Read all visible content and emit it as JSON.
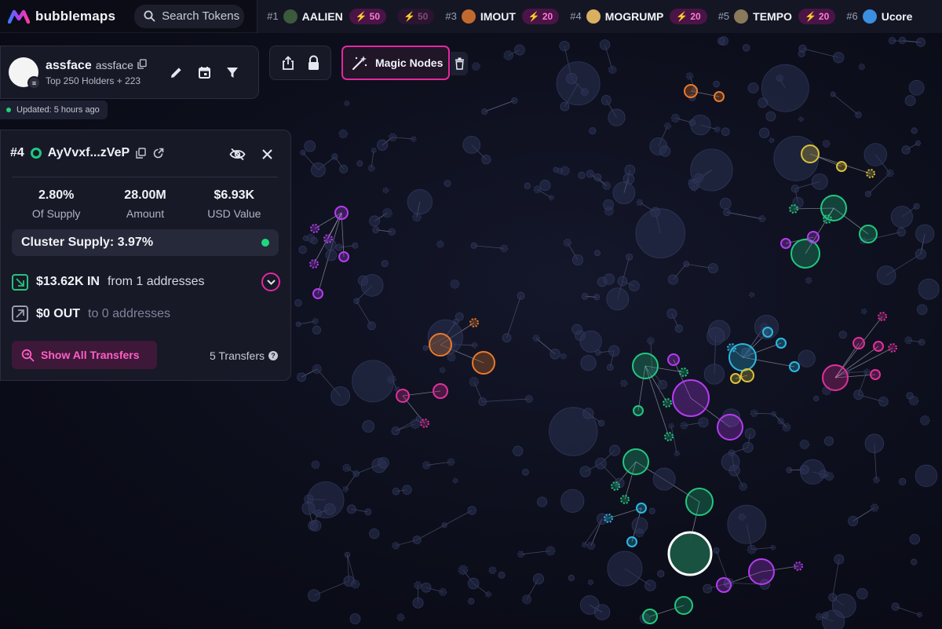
{
  "app": {
    "name": "bubblemaps"
  },
  "search": {
    "label": "Search Tokens"
  },
  "ticker": [
    {
      "rank": "#1",
      "name": "AALIEN",
      "boost": "50",
      "avatar": "#3c5a3c"
    },
    {
      "rank": "",
      "name": "",
      "boost": "50",
      "avatar": "",
      "faded": true
    },
    {
      "rank": "#3",
      "name": "IMOUT",
      "boost": "20",
      "avatar": "#c26a2e"
    },
    {
      "rank": "#4",
      "name": "MOGRUMP",
      "boost": "20",
      "avatar": "#d9b060"
    },
    {
      "rank": "#5",
      "name": "TEMPO",
      "boost": "20",
      "avatar": "#8a7a5a"
    },
    {
      "rank": "#6",
      "name": "Ucore",
      "boost": "",
      "avatar": "#3a8fe0"
    }
  ],
  "header": {
    "token_name": "assface",
    "token_symbol": "assface",
    "meta": "Top 250 Holders + 223",
    "updated": "Updated: 5 hours ago"
  },
  "magic_nodes": {
    "label": "Magic Nodes"
  },
  "panel": {
    "rank": "#4",
    "address": "AyVvxf...zVeP",
    "stats": [
      {
        "value": "2.80%",
        "label": "Of Supply"
      },
      {
        "value": "28.00M",
        "label": "Amount"
      },
      {
        "value": "$6.93K",
        "label": "USD Value"
      }
    ],
    "cluster_supply": "Cluster Supply: 3.97%",
    "inflow": {
      "amount": "$13.62K IN",
      "desc": "from 1 addresses"
    },
    "outflow": {
      "amount": "$0 OUT",
      "desc": "to 0 addresses"
    },
    "show_transfers": "Show All Transfers",
    "transfers_count": "5 Transfers"
  },
  "colors": {
    "accent": "#e4289f",
    "green": "#22c77f",
    "purple": "#b43cf0",
    "orange": "#e87a2c",
    "yellow": "#d9c23a",
    "cyan": "#2cb8e0",
    "pink": "#e0309a",
    "neutral": "#3a4466"
  }
}
